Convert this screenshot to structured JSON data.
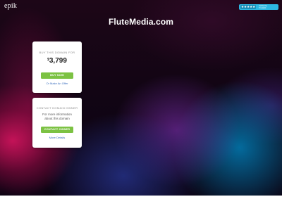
{
  "brand": {
    "logo_text": "epik"
  },
  "trust_badge": {
    "stars": "★★★★★",
    "line1": "Verified by",
    "line2": "Trustpilot"
  },
  "page": {
    "domain_title": "FluteMedia.com"
  },
  "buy_card": {
    "label": "BUY THIS DOMAIN FOR",
    "currency": "$",
    "price": "3,799",
    "button": "BUY NOW",
    "offer_link": "Or Make An Offer"
  },
  "contact_card": {
    "label": "CONTACT DOMAIN OWNER",
    "description_line1": "For more information",
    "description_line2": "about this domain",
    "button": "CONTACT OWNER",
    "details_link": "More Details"
  },
  "colors": {
    "button_green": "#7cc243",
    "link_blue": "#3b6fbf",
    "badge_blue": "#2db7e2"
  }
}
